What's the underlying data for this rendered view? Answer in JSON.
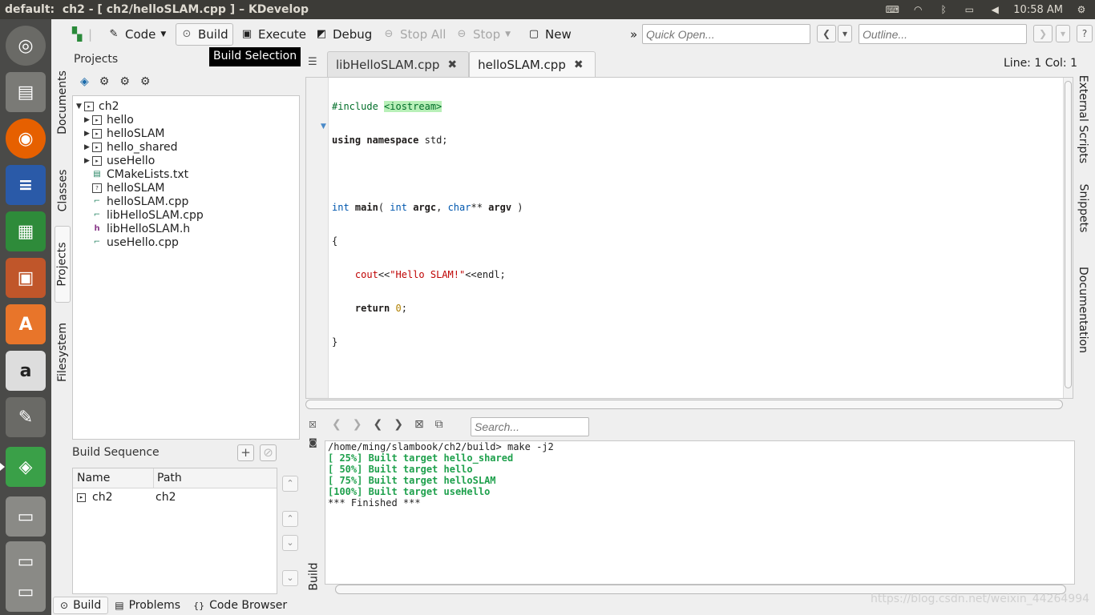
{
  "window_title": "default:  ch2 - [ ch2/helloSLAM.cpp ] – KDevelop",
  "tray": {
    "time": "10:58 AM"
  },
  "toolbar": {
    "code": "Code",
    "build": "Build",
    "execute": "Execute",
    "debug": "Debug",
    "stop_all": "Stop All",
    "stop": "Stop",
    "new": "New",
    "more": "»",
    "quick_open_placeholder": "Quick Open...",
    "outline_placeholder": "Outline..."
  },
  "tooltip": "Build Selection",
  "left_tabs": [
    "Documents",
    "Classes",
    "Projects",
    "Filesystem"
  ],
  "projects": {
    "title": "Projects",
    "tree": [
      {
        "label": "ch2",
        "level": 0,
        "expand": "▼",
        "icon": "folder"
      },
      {
        "label": "hello",
        "level": 1,
        "expand": "▶",
        "icon": "target"
      },
      {
        "label": "helloSLAM",
        "level": 1,
        "expand": "▶",
        "icon": "target"
      },
      {
        "label": "hello_shared",
        "level": 1,
        "expand": "▶",
        "icon": "target"
      },
      {
        "label": "useHello",
        "level": 1,
        "expand": "▶",
        "icon": "target"
      },
      {
        "label": "CMakeLists.txt",
        "level": 1,
        "expand": "",
        "icon": "cmake"
      },
      {
        "label": "helloSLAM",
        "level": 1,
        "expand": "",
        "icon": "unknown"
      },
      {
        "label": "helloSLAM.cpp",
        "level": 1,
        "expand": "",
        "icon": "cpp"
      },
      {
        "label": "libHelloSLAM.cpp",
        "level": 1,
        "expand": "",
        "icon": "cpp"
      },
      {
        "label": "libHelloSLAM.h",
        "level": 1,
        "expand": "",
        "icon": "header"
      },
      {
        "label": "useHello.cpp",
        "level": 1,
        "expand": "",
        "icon": "cpp"
      }
    ]
  },
  "build_sequence": {
    "title": "Build Sequence",
    "columns": [
      "Name",
      "Path"
    ],
    "rows": [
      {
        "name": "ch2",
        "path": "ch2"
      }
    ]
  },
  "bottom_tabs": [
    "Build",
    "Problems",
    "Code Browser"
  ],
  "editor": {
    "tabs": [
      {
        "label": "libHelloSLAM.cpp",
        "active": false
      },
      {
        "label": "helloSLAM.cpp",
        "active": true
      }
    ],
    "cursor": "Line: 1 Col: 1",
    "code": {
      "l1_pp": "#include ",
      "l1_inc": "<iostream>",
      "l2_using": "using",
      "l2_namespace": "namespace",
      "l2_rest": " std;",
      "l4_int": "int",
      "l4_main": "main",
      "l4_paren": "( ",
      "l4_int2": "int",
      "l4_argc": "argc",
      "l4_comma": ", ",
      "l4_char": "char",
      "l4_stars": "** ",
      "l4_argv": "argv",
      "l4_close": " )",
      "l5": "{",
      "l6_cout": "cout",
      "l6_op1": "<<",
      "l6_str": "\"Hello SLAM!\"",
      "l6_op2": "<<",
      "l6_endl": "endl;",
      "l7_return": "return",
      "l7_num": "0",
      "l7_semi": ";",
      "l8": "}"
    }
  },
  "right_tabs": [
    "External Scripts",
    "Snippets",
    "Documentation"
  ],
  "output": {
    "search_placeholder": "Search...",
    "tab_label": "Build",
    "lines": [
      {
        "text": "/home/ming/slambook/ch2/build> make -j2",
        "ok": false
      },
      {
        "text": "[ 25%] Built target hello_shared",
        "ok": true
      },
      {
        "text": "[ 50%] Built target hello",
        "ok": true
      },
      {
        "text": "[ 75%] Built target helloSLAM",
        "ok": true
      },
      {
        "text": "[100%] Built target useHello",
        "ok": true
      },
      {
        "text": "*** Finished ***",
        "ok": false
      }
    ]
  },
  "watermark": "https://blog.csdn.net/weixin_44264994",
  "colors": {
    "ok_green": "#1ea04c",
    "tooltip_bg": "#000000",
    "panel_bg": "#3c3b37",
    "launcher_bg": "#4a4a48"
  }
}
